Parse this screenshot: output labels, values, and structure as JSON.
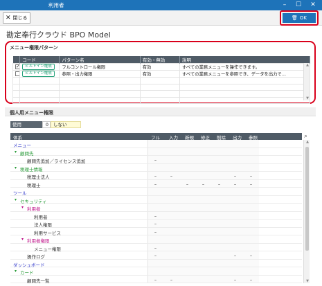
{
  "window": {
    "title": "利用者",
    "min": "–",
    "max": "☐",
    "close": "✕"
  },
  "toolbar": {
    "close_label": "閉じる",
    "ok_label": "OK"
  },
  "app_title": "勘定奉行クラウド BPO Model",
  "pattern_section": {
    "title": "メニュー権限パターン",
    "columns": [
      "コード",
      "パターン名",
      "有効・無効",
      "説明"
    ],
    "rows": [
      {
        "checked": true,
        "code": "ビルトイン権限",
        "name": "フルコントロール権限",
        "status": "有効",
        "desc": "すべての業務メニューを操作できます。"
      },
      {
        "checked": false,
        "code": "ビルトイン権限",
        "name": "参照・出力権限",
        "status": "有効",
        "desc": "すべての業務メニューを参照でき、データを出力で…"
      }
    ]
  },
  "personal_section": {
    "title": "個人用メニュー権限"
  },
  "usage": {
    "label": "使用",
    "value": "0",
    "text": "しない"
  },
  "tree": {
    "columns": [
      "体系",
      "フル",
      "入力",
      "新規",
      "修正",
      "削除",
      "出力",
      "参照"
    ],
    "rows": [
      {
        "label": "メニュー",
        "level": 0,
        "color": "#2b33c9",
        "cells": [
          "",
          "",
          "",
          "",
          "",
          "",
          ""
        ]
      },
      {
        "label": "顧問先",
        "level": 1,
        "color": "#2a9c3a",
        "cells": [
          "",
          "",
          "",
          "",
          "",
          "",
          ""
        ]
      },
      {
        "label": "顧問先追加／ライセンス追加",
        "level": 2,
        "color": "#333",
        "cells": [
          "–",
          "",
          "",
          "",
          "",
          "",
          ""
        ]
      },
      {
        "label": "税理士情報",
        "level": 1,
        "color": "#2a9c3a",
        "cells": [
          "",
          "",
          "",
          "",
          "",
          "",
          ""
        ]
      },
      {
        "label": "税理士法人",
        "level": 2,
        "color": "#333",
        "cells": [
          "–",
          "–",
          "",
          "",
          "",
          "–",
          "–"
        ]
      },
      {
        "label": "税理士",
        "level": 2,
        "color": "#333",
        "cells": [
          "–",
          "",
          "–",
          "–",
          "–",
          "–",
          "–"
        ]
      },
      {
        "label": "ツール",
        "level": 0,
        "color": "#2b33c9",
        "cells": [
          "",
          "",
          "",
          "",
          "",
          "",
          ""
        ]
      },
      {
        "label": "セキュリティ",
        "level": 1,
        "color": "#2a9c3a",
        "cells": [
          "",
          "",
          "",
          "",
          "",
          "",
          ""
        ]
      },
      {
        "label": "利用者",
        "level": 2,
        "color": "#c0178b",
        "cells": [
          "",
          "",
          "",
          "",
          "",
          "",
          ""
        ]
      },
      {
        "label": "利用者",
        "level": 3,
        "color": "#333",
        "cells": [
          "–",
          "",
          "",
          "",
          "",
          "",
          ""
        ]
      },
      {
        "label": "法人権限",
        "level": 3,
        "color": "#333",
        "cells": [
          "–",
          "",
          "",
          "",
          "",
          "",
          ""
        ]
      },
      {
        "label": "利用サービス",
        "level": 3,
        "color": "#333",
        "cells": [
          "–",
          "",
          "",
          "",
          "",
          "",
          ""
        ]
      },
      {
        "label": "利用者権限",
        "level": 2,
        "color": "#c0178b",
        "cells": [
          "",
          "",
          "",
          "",
          "",
          "",
          ""
        ]
      },
      {
        "label": "メニュー権限",
        "level": 3,
        "color": "#333",
        "cells": [
          "–",
          "",
          "",
          "",
          "",
          "",
          ""
        ]
      },
      {
        "label": "操作ログ",
        "level": 2,
        "color": "#333",
        "cells": [
          "–",
          "",
          "",
          "",
          "",
          "–",
          "–"
        ]
      },
      {
        "label": "ダッシュボード",
        "level": 0,
        "color": "#2b33c9",
        "cells": [
          "",
          "",
          "",
          "",
          "",
          "",
          ""
        ]
      },
      {
        "label": "カード",
        "level": 1,
        "color": "#2a9c3a",
        "cells": [
          "",
          "",
          "",
          "",
          "",
          "",
          ""
        ]
      },
      {
        "label": "顧問先一覧",
        "level": 2,
        "color": "#333",
        "cells": [
          "–",
          "–",
          "",
          "",
          "",
          "–",
          "–"
        ]
      }
    ]
  }
}
